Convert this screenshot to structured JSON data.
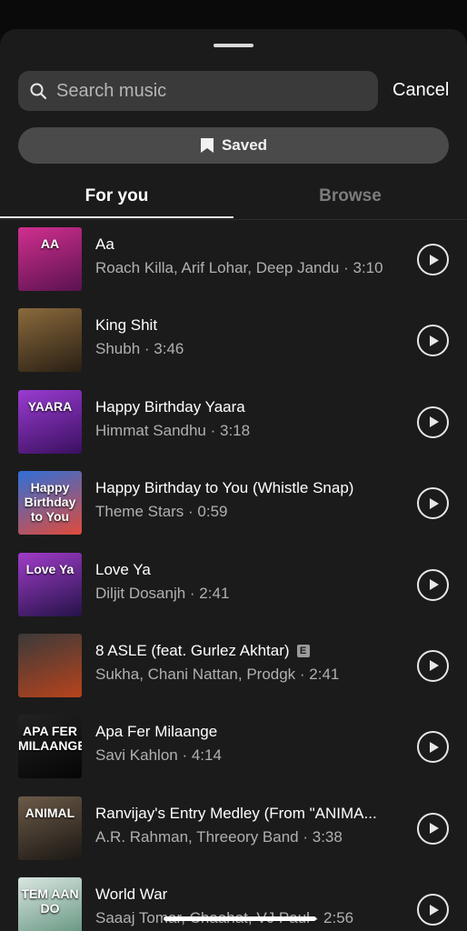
{
  "search": {
    "placeholder": "Search music",
    "icon": "search-icon"
  },
  "cancel_label": "Cancel",
  "saved": {
    "label": "Saved",
    "icon": "bookmark-icon"
  },
  "tabs": [
    {
      "label": "For you",
      "active": true
    },
    {
      "label": "Browse",
      "active": false
    }
  ],
  "tracks": [
    {
      "title": "Aa",
      "subtitle": "Roach Killa, Arif Lohar, Deep Jandu · 3:10",
      "art_text": "AA",
      "art_colors": [
        "#d12f8f",
        "#5a1250"
      ]
    },
    {
      "title": "King Shit",
      "subtitle": "Shubh · 3:46",
      "art_text": "",
      "art_colors": [
        "#8a6a3c",
        "#2a1f14"
      ]
    },
    {
      "title": "Happy Birthday Yaara",
      "subtitle": "Himmat Sandhu · 3:18",
      "art_text": "YAARA",
      "art_colors": [
        "#9a3bd1",
        "#3a1060"
      ]
    },
    {
      "title": "Happy Birthday to You (Whistle Snap)",
      "subtitle": "Theme Stars · 0:59",
      "art_text": "Happy Birthday to You",
      "art_colors": [
        "#2f6fd8",
        "#e04b3a"
      ]
    },
    {
      "title": "Love Ya",
      "subtitle": "Diljit Dosanjh · 2:41",
      "art_text": "Love Ya",
      "art_colors": [
        "#a03cc8",
        "#25134a"
      ]
    },
    {
      "title": "8 ASLE (feat. Gurlez Akhtar)",
      "subtitle": "Sukha, Chani Nattan, Prodgk · 2:41",
      "explicit": "E",
      "art_text": "",
      "art_colors": [
        "#3a3a3a",
        "#b8431c"
      ]
    },
    {
      "title": "Apa Fer Milaange",
      "subtitle": "Savi Kahlon · 4:14",
      "art_text": "APA FER MILAANGE",
      "art_colors": [
        "#222222",
        "#050505"
      ]
    },
    {
      "title": "Ranvijay's Entry Medley (From \"ANIMA...",
      "subtitle": "A.R. Rahman, Threeory Band · 3:38",
      "art_text": "ANIMAL",
      "art_colors": [
        "#6b5a48",
        "#1c1814"
      ]
    },
    {
      "title": "World War",
      "subtitle": "Saaaj Tomar, Chaahat, VJ Paul · 2:56",
      "art_text": "TEM AAN DO",
      "art_colors": [
        "#d9e6e0",
        "#5d8f7a"
      ]
    }
  ],
  "play_icon": "play-icon"
}
